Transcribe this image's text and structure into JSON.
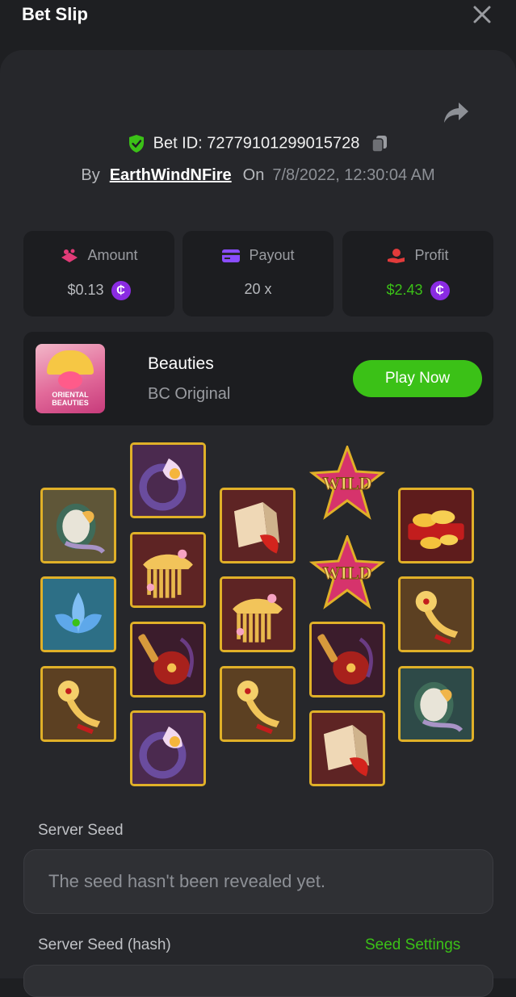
{
  "header": {
    "title": "Bet Slip"
  },
  "bet": {
    "id_label": "Bet ID: 72779101299015728",
    "by_label": "By",
    "username": "EarthWindNFire",
    "on_label": "On",
    "date": "7/8/2022, 12:30:04 AM"
  },
  "stats": {
    "amount": {
      "label": "Amount",
      "value": "$0.13",
      "color": "#e23b78"
    },
    "payout": {
      "label": "Payout",
      "value": "20 x",
      "color": "#8a4dff"
    },
    "profit": {
      "label": "Profit",
      "value": "$2.43",
      "value_color": "#3bc117",
      "color": "#e23b3b"
    },
    "coin_symbol": "₵"
  },
  "game": {
    "thumb_text": "ORIENTAL BEAUTIES",
    "name": "Beauties",
    "provider": "BC Original",
    "play_label": "Play Now"
  },
  "reels": {
    "wild_label": "WILD",
    "columns": [
      [
        "mirror",
        "lotus-blue",
        "ruyi"
      ],
      [
        "ring",
        "comb",
        "pipa",
        "ring"
      ],
      [
        "lantern-fish",
        "comb",
        "ruyi"
      ],
      [
        "wild",
        "wild",
        "pipa",
        "lantern-fish"
      ],
      [
        "gold",
        "ruyi",
        "mirror"
      ]
    ]
  },
  "seeds": {
    "server_seed_label": "Server Seed",
    "server_seed_value": "The seed hasn't been revealed yet.",
    "hash_label": "Server Seed (hash)",
    "seed_settings_label": "Seed Settings"
  },
  "colors": {
    "background": "#1e1f22",
    "panel": "#26272b",
    "card": "#1c1d20",
    "accent_green": "#3bc117",
    "tile_border": "#e0b028",
    "coin": "#8a2be2"
  }
}
